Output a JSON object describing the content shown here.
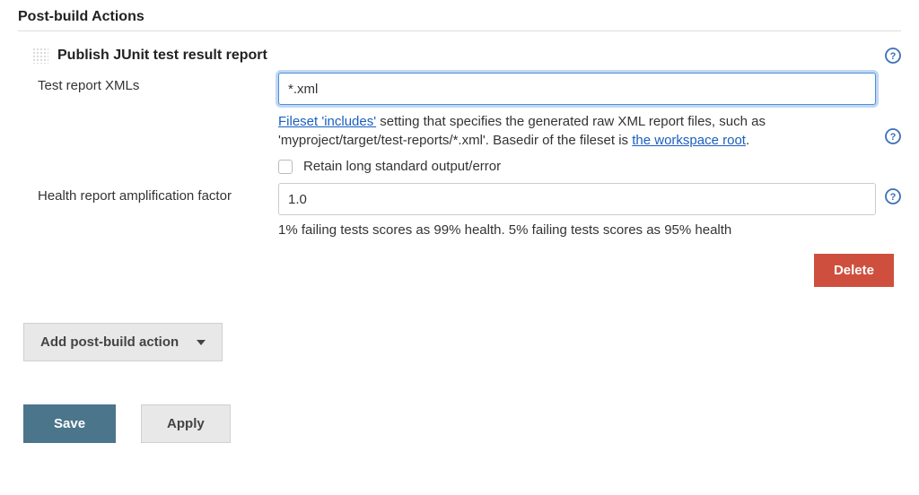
{
  "section_title": "Post-build Actions",
  "block": {
    "title": "Publish JUnit test result report",
    "test_report": {
      "label": "Test report XMLs",
      "value": "*.xml",
      "hint_prefix": "Fileset 'includes'",
      "hint_middle": " setting that specifies the generated raw XML report files, such as 'myproject/target/test-reports/*.xml'. Basedir of the fileset is ",
      "hint_link": "the workspace root",
      "hint_suffix": "."
    },
    "retain_checkbox": {
      "label": "Retain long standard output/error",
      "checked": false
    },
    "health": {
      "label": "Health report amplification factor",
      "value": "1.0",
      "hint": "1% failing tests scores as 99% health. 5% failing tests scores as 95% health"
    },
    "delete_label": "Delete"
  },
  "add_action_label": "Add post-build action",
  "save_label": "Save",
  "apply_label": "Apply"
}
